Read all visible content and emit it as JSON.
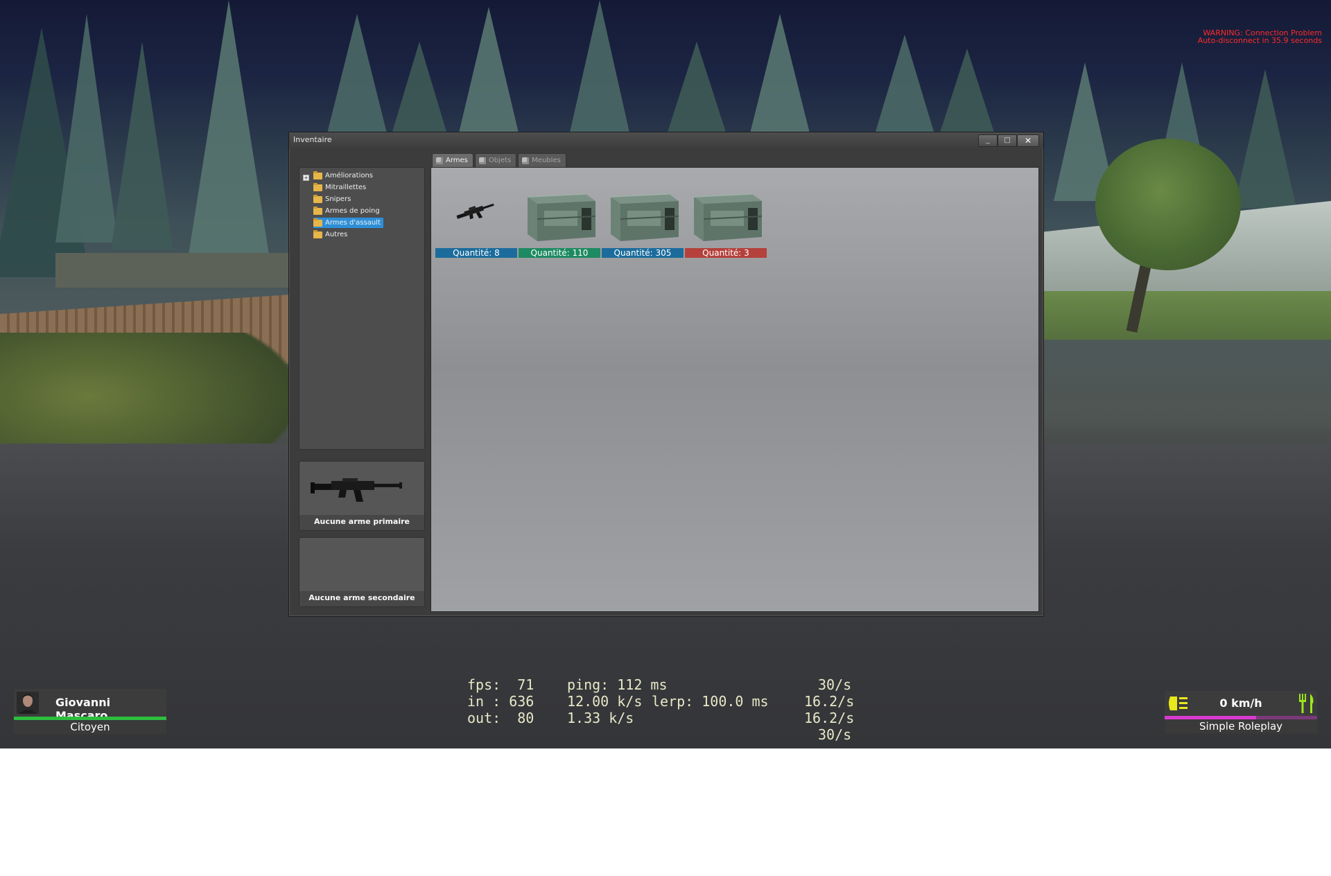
{
  "warning": {
    "line1": "WARNING:  Connection Problem",
    "line2": "Auto-disconnect in 35.9 seconds"
  },
  "window": {
    "title": "Inventaire",
    "buttons": {
      "minimize": "_",
      "maximize": "□",
      "close": "✕"
    }
  },
  "categories": [
    {
      "label": "Améliorations",
      "selected": false
    },
    {
      "label": "Mitraillettes",
      "selected": false
    },
    {
      "label": "Snipers",
      "selected": false
    },
    {
      "label": "Armes de poing",
      "selected": false
    },
    {
      "label": "Armes d'assault",
      "selected": true
    },
    {
      "label": "Autres",
      "selected": false
    }
  ],
  "tabs": [
    {
      "label": "Armes",
      "active": true
    },
    {
      "label": "Objets",
      "active": false
    },
    {
      "label": "Meubles",
      "active": false
    }
  ],
  "items": [
    {
      "icon": "assault-rifle-icon",
      "quantity": "Quantité: 8",
      "color": "#1b6c9c"
    },
    {
      "icon": "ammo-crate-icon",
      "quantity": "Quantité: 110",
      "color": "#1e8a62"
    },
    {
      "icon": "ammo-crate-icon",
      "quantity": "Quantité: 305",
      "color": "#1b6c9c"
    },
    {
      "icon": "ammo-crate-icon",
      "quantity": "Quantité: 3",
      "color": "#b4413c"
    }
  ],
  "slots": {
    "primary": "Aucune arme primaire",
    "secondary": "Aucune arme secondaire"
  },
  "hud": {
    "player_name": "Giovanni Mascaro",
    "job": "Citoyen",
    "speed": "0 km/h",
    "server": "Simple Roleplay",
    "health_color": "#2ebd3f",
    "hunger_color": "#d83ad1"
  },
  "netgraph": {
    "fps": "fps:  71",
    "ping": "ping: 112 ms",
    "rate1": "30/s",
    "in": "in : 636",
    "in_rate": "12.00 k/s",
    "lerp": "lerp: 100.0 ms",
    "rate2": "16.2/s",
    "out": "out:  80",
    "out_rate": "1.33 k/s",
    "rate3": "16.2/s",
    "rate4": "30/s"
  }
}
